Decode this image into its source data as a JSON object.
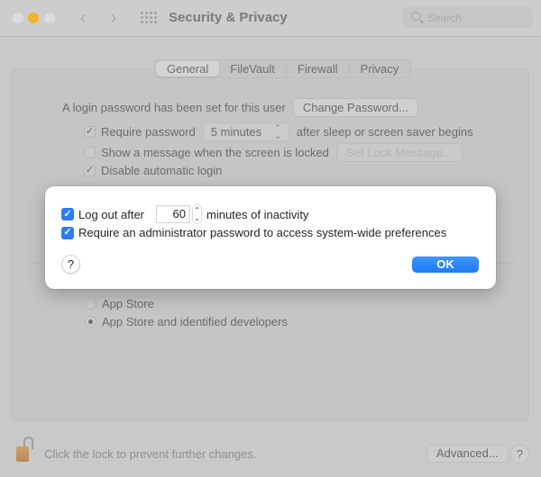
{
  "window": {
    "title": "Security & Privacy",
    "search_placeholder": "Search",
    "traffic_lights": {
      "close": "#dcdcdc",
      "minimize": "#f3b12a",
      "zoom": "#dcdcdc"
    },
    "nav_back_glyph": "‹",
    "nav_forward_glyph": "›"
  },
  "tabs": [
    {
      "label": "General",
      "active": true
    },
    {
      "label": "FileVault",
      "active": false
    },
    {
      "label": "Firewall",
      "active": false
    },
    {
      "label": "Privacy",
      "active": false
    }
  ],
  "general": {
    "login_password_text": "A login password has been set for this user",
    "change_password_button": "Change Password...",
    "require_password": {
      "checked": true,
      "label": "Require password",
      "popup_value": "5 minutes",
      "suffix": "after sleep or screen saver begins"
    },
    "show_message": {
      "checked": false,
      "label": "Show a message when the screen is locked",
      "button": "Set Lock Message..."
    },
    "disable_auto_login": {
      "checked": true,
      "label": "Disable automatic login"
    },
    "allow_apps": {
      "options": [
        {
          "label": "App Store",
          "selected": false
        },
        {
          "label": "App Store and identified developers",
          "selected": true
        }
      ]
    }
  },
  "footer": {
    "lock_text": "Click the lock to prevent further changes.",
    "advanced_button": "Advanced...",
    "help_label": "?"
  },
  "sheet": {
    "logout": {
      "checked": true,
      "label_before": "Log out after",
      "value": "60",
      "label_after": "minutes of inactivity"
    },
    "require_admin": {
      "checked": true,
      "label": "Require an administrator password to access system-wide preferences"
    },
    "help_label": "?",
    "ok_button": "OK",
    "accent_color": "#2b7cf5"
  },
  "glyphs": {
    "check": "✓",
    "up": "⌃",
    "down": "⌄",
    "chevrons": "⌃⌄"
  }
}
